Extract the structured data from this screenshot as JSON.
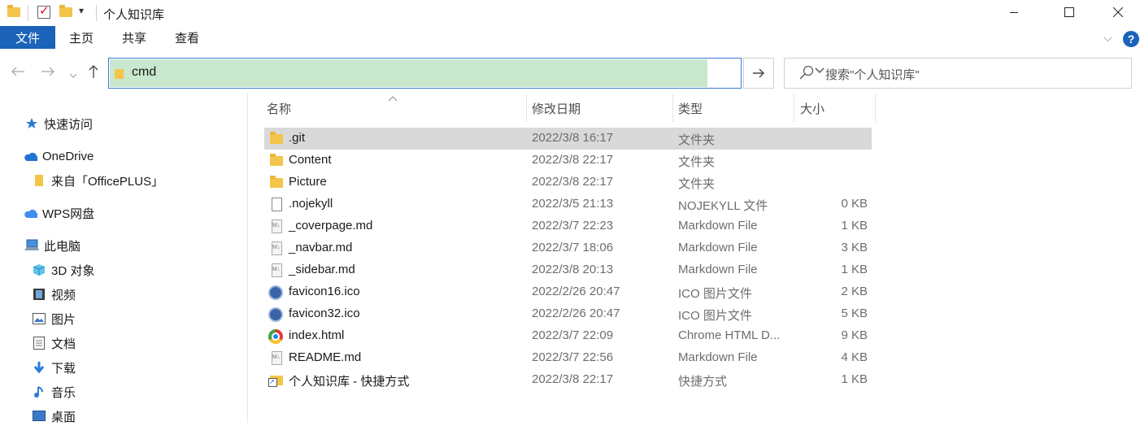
{
  "window": {
    "title": "个人知识库",
    "qa_dropdown": "▾"
  },
  "ribbon": {
    "tabs": [
      "文件",
      "主页",
      "共享",
      "查看"
    ],
    "collapse_glyph": "⌵",
    "help_glyph": "?"
  },
  "address": {
    "path": "cmd",
    "search_placeholder": "搜索\"个人知识库\""
  },
  "nav_pane": {
    "items": [
      {
        "label": "快速访问",
        "icon": "star-icon"
      },
      {
        "label": "OneDrive",
        "icon": "cloud-icon"
      },
      {
        "label": "来自「OfficePLUS」",
        "icon": "folder-icon"
      },
      {
        "label": "WPS网盘",
        "icon": "wps-cloud-icon"
      },
      {
        "label": "此电脑",
        "icon": "computer-icon"
      },
      {
        "label": "3D 对象",
        "icon": "cube-icon"
      },
      {
        "label": "视频",
        "icon": "film-icon"
      },
      {
        "label": "图片",
        "icon": "picture-icon"
      },
      {
        "label": "文档",
        "icon": "document-icon"
      },
      {
        "label": "下载",
        "icon": "download-icon"
      },
      {
        "label": "音乐",
        "icon": "music-icon"
      },
      {
        "label": "桌面",
        "icon": "desktop-icon"
      }
    ]
  },
  "file_list": {
    "columns": [
      "名称",
      "修改日期",
      "类型",
      "大小"
    ],
    "files": [
      {
        "name": ".git",
        "date": "2022/3/8 16:17",
        "type": "文件夹",
        "size": "",
        "icon": "folder-icon",
        "selected": true
      },
      {
        "name": "Content",
        "date": "2022/3/8 22:17",
        "type": "文件夹",
        "size": "",
        "icon": "folder-icon"
      },
      {
        "name": "Picture",
        "date": "2022/3/8 22:17",
        "type": "文件夹",
        "size": "",
        "icon": "folder-icon"
      },
      {
        "name": ".nojekyll",
        "date": "2022/3/5 21:13",
        "type": "NOJEKYLL 文件",
        "size": "0 KB",
        "icon": "blank-file-icon"
      },
      {
        "name": "_coverpage.md",
        "date": "2022/3/7 22:23",
        "type": "Markdown File",
        "size": "1 KB",
        "icon": "markdown-icon"
      },
      {
        "name": "_navbar.md",
        "date": "2022/3/7 18:06",
        "type": "Markdown File",
        "size": "3 KB",
        "icon": "markdown-icon"
      },
      {
        "name": "_sidebar.md",
        "date": "2022/3/8 20:13",
        "type": "Markdown File",
        "size": "1 KB",
        "icon": "markdown-icon"
      },
      {
        "name": "favicon16.ico",
        "date": "2022/2/26 20:47",
        "type": "ICO 图片文件",
        "size": "2 KB",
        "icon": "ico-file-icon"
      },
      {
        "name": "favicon32.ico",
        "date": "2022/2/26 20:47",
        "type": "ICO 图片文件",
        "size": "5 KB",
        "icon": "ico-file-icon"
      },
      {
        "name": "index.html",
        "date": "2022/3/7 22:09",
        "type": "Chrome HTML D...",
        "size": "9 KB",
        "icon": "chrome-icon"
      },
      {
        "name": "README.md",
        "date": "2022/3/7 22:56",
        "type": "Markdown File",
        "size": "4 KB",
        "icon": "markdown-icon"
      },
      {
        "name": "个人知识库 - 快捷方式",
        "date": "2022/3/8 22:17",
        "type": "快捷方式",
        "size": "1 KB",
        "icon": "shortcut-icon"
      }
    ]
  },
  "colors": {
    "accent": "#1a63b8",
    "address_fill": "#c9e7cd",
    "selection": "#d9d9d9"
  }
}
